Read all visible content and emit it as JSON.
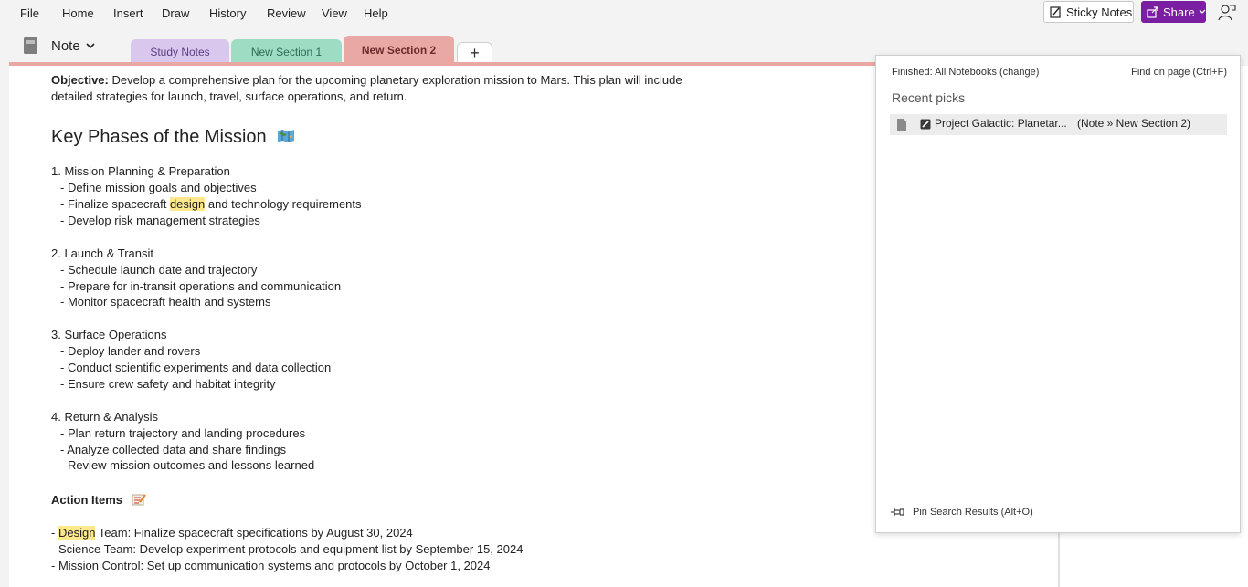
{
  "menubar": {
    "items": [
      "File",
      "Home",
      "Insert",
      "Draw",
      "History",
      "Review",
      "View",
      "Help"
    ],
    "sticky_label": "Sticky Notes",
    "share_label": "Share"
  },
  "notebook": {
    "name": "Note",
    "tabs": [
      {
        "label": "Study Notes"
      },
      {
        "label": "New Section 1"
      },
      {
        "label": "New Section 2"
      }
    ],
    "add_tab_label": "+"
  },
  "search": {
    "value": "design"
  },
  "page": {
    "objective_label": "Objective:",
    "objective_line1": " Develop a comprehensive plan for the upcoming planetary exploration mission to Mars. This plan will include",
    "objective_line2": "detailed strategies for launch, travel, surface operations, and return.",
    "heading": "Key Phases of the Mission",
    "phases": [
      {
        "title": "1. Mission Planning & Preparation",
        "items": [
          {
            "pre": "- Define mission goals and objectives",
            "hl": "",
            "post": ""
          },
          {
            "pre": "- Finalize spacecraft ",
            "hl": "design",
            "post": " and technology requirements"
          },
          {
            "pre": "- Develop risk management strategies",
            "hl": "",
            "post": ""
          }
        ]
      },
      {
        "title": "2. Launch & Transit",
        "items": [
          {
            "pre": "- Schedule launch date and trajectory",
            "hl": "",
            "post": ""
          },
          {
            "pre": "- Prepare for in-transit operations and communication",
            "hl": "",
            "post": ""
          },
          {
            "pre": "- Monitor spacecraft health and systems",
            "hl": "",
            "post": ""
          }
        ]
      },
      {
        "title": "3. Surface Operations",
        "items": [
          {
            "pre": "- Deploy lander and rovers",
            "hl": "",
            "post": ""
          },
          {
            "pre": "- Conduct scientific experiments and data collection",
            "hl": "",
            "post": ""
          },
          {
            "pre": "- Ensure crew safety and habitat integrity",
            "hl": "",
            "post": ""
          }
        ]
      },
      {
        "title": "4. Return & Analysis",
        "items": [
          {
            "pre": "- Plan return trajectory and landing procedures",
            "hl": "",
            "post": ""
          },
          {
            "pre": "- Analyze collected data and share findings",
            "hl": "",
            "post": ""
          },
          {
            "pre": "- Review mission outcomes and lessons learned",
            "hl": "",
            "post": ""
          }
        ]
      }
    ],
    "action_heading": "Action Items",
    "actions": [
      {
        "pre": "- ",
        "hl": "Design",
        "post": " Team: Finalize spacecraft specifications by August 30, 2024"
      },
      {
        "pre": "- Science Team: Develop experiment protocols and equipment list by September 15, 2024",
        "hl": "",
        "post": ""
      },
      {
        "pre": "- Mission Control: Set up communication systems and protocols by October 1, 2024",
        "hl": "",
        "post": ""
      }
    ]
  },
  "results": {
    "status": "Finished:  All Notebooks (change)",
    "find_on_page": "Find on page (Ctrl+F)",
    "heading": "Recent picks",
    "item_title": "Project Galactic: Planetar...",
    "item_path": "(Note » New Section 2)",
    "pin_label": "Pin Search Results (Alt+O)"
  },
  "colors": {
    "share": "#7b1fa2",
    "tab_study": "#d9c7ee",
    "tab_new1": "#9fdcc4",
    "tab_new2": "#eaa8a4",
    "highlight": "#fde98c"
  }
}
